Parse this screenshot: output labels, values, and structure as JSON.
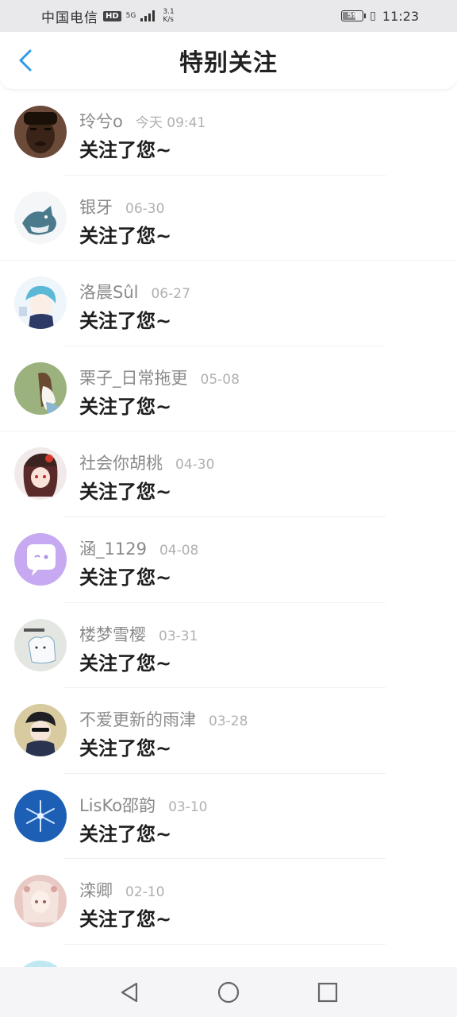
{
  "status_bar": {
    "carrier": "中国电信",
    "hd": "HD",
    "network": "5G",
    "speed_value": "3.1",
    "speed_unit": "K/s",
    "battery": "59",
    "time": "11:23"
  },
  "header": {
    "title": "特别关注"
  },
  "list": {
    "items": [
      {
        "name": "玲兮o",
        "time": "今天 09:41",
        "message": "关注了您~",
        "avatar_bg": "#5a3a2a"
      },
      {
        "name": "银牙",
        "time": "06-30",
        "message": "关注了您~",
        "avatar_bg": "#f4f6f8"
      },
      {
        "name": "洛晨Sûl",
        "time": "06-27",
        "message": "关注了您~",
        "avatar_bg": "#e8f2fa"
      },
      {
        "name": "栗子_日常拖更",
        "time": "05-08",
        "message": "关注了您~",
        "avatar_bg": "#9bb27e"
      },
      {
        "name": "社会你胡桃",
        "time": "04-30",
        "message": "关注了您~",
        "avatar_bg": "#3a2228"
      },
      {
        "name": "涵_1129",
        "time": "04-08",
        "message": "关注了您~",
        "avatar_bg": "#c7a9f2"
      },
      {
        "name": "楼梦雪樱",
        "time": "03-31",
        "message": "关注了您~",
        "avatar_bg": "#e4e6e2"
      },
      {
        "name": "不爱更新的雨津",
        "time": "03-28",
        "message": "关注了您~",
        "avatar_bg": "#d8cba0"
      },
      {
        "name": "LisKo邵韵",
        "time": "03-10",
        "message": "关注了您~",
        "avatar_bg": "#1d5fb4"
      },
      {
        "name": "滦卿",
        "time": "02-10",
        "message": "关注了您~",
        "avatar_bg": "#e8c9c4"
      }
    ]
  }
}
